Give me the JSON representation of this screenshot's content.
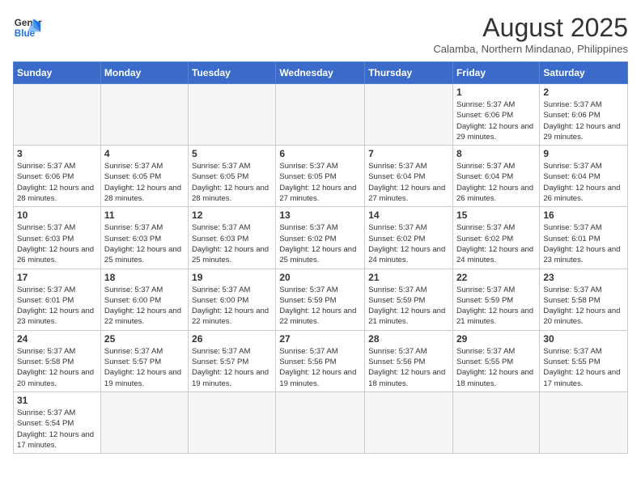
{
  "header": {
    "logo_line1": "General",
    "logo_line2": "Blue",
    "month_title": "August 2025",
    "location": "Calamba, Northern Mindanao, Philippines"
  },
  "weekdays": [
    "Sunday",
    "Monday",
    "Tuesday",
    "Wednesday",
    "Thursday",
    "Friday",
    "Saturday"
  ],
  "weeks": [
    [
      {
        "day": "",
        "info": ""
      },
      {
        "day": "",
        "info": ""
      },
      {
        "day": "",
        "info": ""
      },
      {
        "day": "",
        "info": ""
      },
      {
        "day": "",
        "info": ""
      },
      {
        "day": "1",
        "info": "Sunrise: 5:37 AM\nSunset: 6:06 PM\nDaylight: 12 hours and 29 minutes."
      },
      {
        "day": "2",
        "info": "Sunrise: 5:37 AM\nSunset: 6:06 PM\nDaylight: 12 hours and 29 minutes."
      }
    ],
    [
      {
        "day": "3",
        "info": "Sunrise: 5:37 AM\nSunset: 6:06 PM\nDaylight: 12 hours and 28 minutes."
      },
      {
        "day": "4",
        "info": "Sunrise: 5:37 AM\nSunset: 6:05 PM\nDaylight: 12 hours and 28 minutes."
      },
      {
        "day": "5",
        "info": "Sunrise: 5:37 AM\nSunset: 6:05 PM\nDaylight: 12 hours and 28 minutes."
      },
      {
        "day": "6",
        "info": "Sunrise: 5:37 AM\nSunset: 6:05 PM\nDaylight: 12 hours and 27 minutes."
      },
      {
        "day": "7",
        "info": "Sunrise: 5:37 AM\nSunset: 6:04 PM\nDaylight: 12 hours and 27 minutes."
      },
      {
        "day": "8",
        "info": "Sunrise: 5:37 AM\nSunset: 6:04 PM\nDaylight: 12 hours and 26 minutes."
      },
      {
        "day": "9",
        "info": "Sunrise: 5:37 AM\nSunset: 6:04 PM\nDaylight: 12 hours and 26 minutes."
      }
    ],
    [
      {
        "day": "10",
        "info": "Sunrise: 5:37 AM\nSunset: 6:03 PM\nDaylight: 12 hours and 26 minutes."
      },
      {
        "day": "11",
        "info": "Sunrise: 5:37 AM\nSunset: 6:03 PM\nDaylight: 12 hours and 25 minutes."
      },
      {
        "day": "12",
        "info": "Sunrise: 5:37 AM\nSunset: 6:03 PM\nDaylight: 12 hours and 25 minutes."
      },
      {
        "day": "13",
        "info": "Sunrise: 5:37 AM\nSunset: 6:02 PM\nDaylight: 12 hours and 25 minutes."
      },
      {
        "day": "14",
        "info": "Sunrise: 5:37 AM\nSunset: 6:02 PM\nDaylight: 12 hours and 24 minutes."
      },
      {
        "day": "15",
        "info": "Sunrise: 5:37 AM\nSunset: 6:02 PM\nDaylight: 12 hours and 24 minutes."
      },
      {
        "day": "16",
        "info": "Sunrise: 5:37 AM\nSunset: 6:01 PM\nDaylight: 12 hours and 23 minutes."
      }
    ],
    [
      {
        "day": "17",
        "info": "Sunrise: 5:37 AM\nSunset: 6:01 PM\nDaylight: 12 hours and 23 minutes."
      },
      {
        "day": "18",
        "info": "Sunrise: 5:37 AM\nSunset: 6:00 PM\nDaylight: 12 hours and 22 minutes."
      },
      {
        "day": "19",
        "info": "Sunrise: 5:37 AM\nSunset: 6:00 PM\nDaylight: 12 hours and 22 minutes."
      },
      {
        "day": "20",
        "info": "Sunrise: 5:37 AM\nSunset: 5:59 PM\nDaylight: 12 hours and 22 minutes."
      },
      {
        "day": "21",
        "info": "Sunrise: 5:37 AM\nSunset: 5:59 PM\nDaylight: 12 hours and 21 minutes."
      },
      {
        "day": "22",
        "info": "Sunrise: 5:37 AM\nSunset: 5:59 PM\nDaylight: 12 hours and 21 minutes."
      },
      {
        "day": "23",
        "info": "Sunrise: 5:37 AM\nSunset: 5:58 PM\nDaylight: 12 hours and 20 minutes."
      }
    ],
    [
      {
        "day": "24",
        "info": "Sunrise: 5:37 AM\nSunset: 5:58 PM\nDaylight: 12 hours and 20 minutes."
      },
      {
        "day": "25",
        "info": "Sunrise: 5:37 AM\nSunset: 5:57 PM\nDaylight: 12 hours and 19 minutes."
      },
      {
        "day": "26",
        "info": "Sunrise: 5:37 AM\nSunset: 5:57 PM\nDaylight: 12 hours and 19 minutes."
      },
      {
        "day": "27",
        "info": "Sunrise: 5:37 AM\nSunset: 5:56 PM\nDaylight: 12 hours and 19 minutes."
      },
      {
        "day": "28",
        "info": "Sunrise: 5:37 AM\nSunset: 5:56 PM\nDaylight: 12 hours and 18 minutes."
      },
      {
        "day": "29",
        "info": "Sunrise: 5:37 AM\nSunset: 5:55 PM\nDaylight: 12 hours and 18 minutes."
      },
      {
        "day": "30",
        "info": "Sunrise: 5:37 AM\nSunset: 5:55 PM\nDaylight: 12 hours and 17 minutes."
      }
    ],
    [
      {
        "day": "31",
        "info": "Sunrise: 5:37 AM\nSunset: 5:54 PM\nDaylight: 12 hours and 17 minutes."
      },
      {
        "day": "",
        "info": ""
      },
      {
        "day": "",
        "info": ""
      },
      {
        "day": "",
        "info": ""
      },
      {
        "day": "",
        "info": ""
      },
      {
        "day": "",
        "info": ""
      },
      {
        "day": "",
        "info": ""
      }
    ]
  ]
}
